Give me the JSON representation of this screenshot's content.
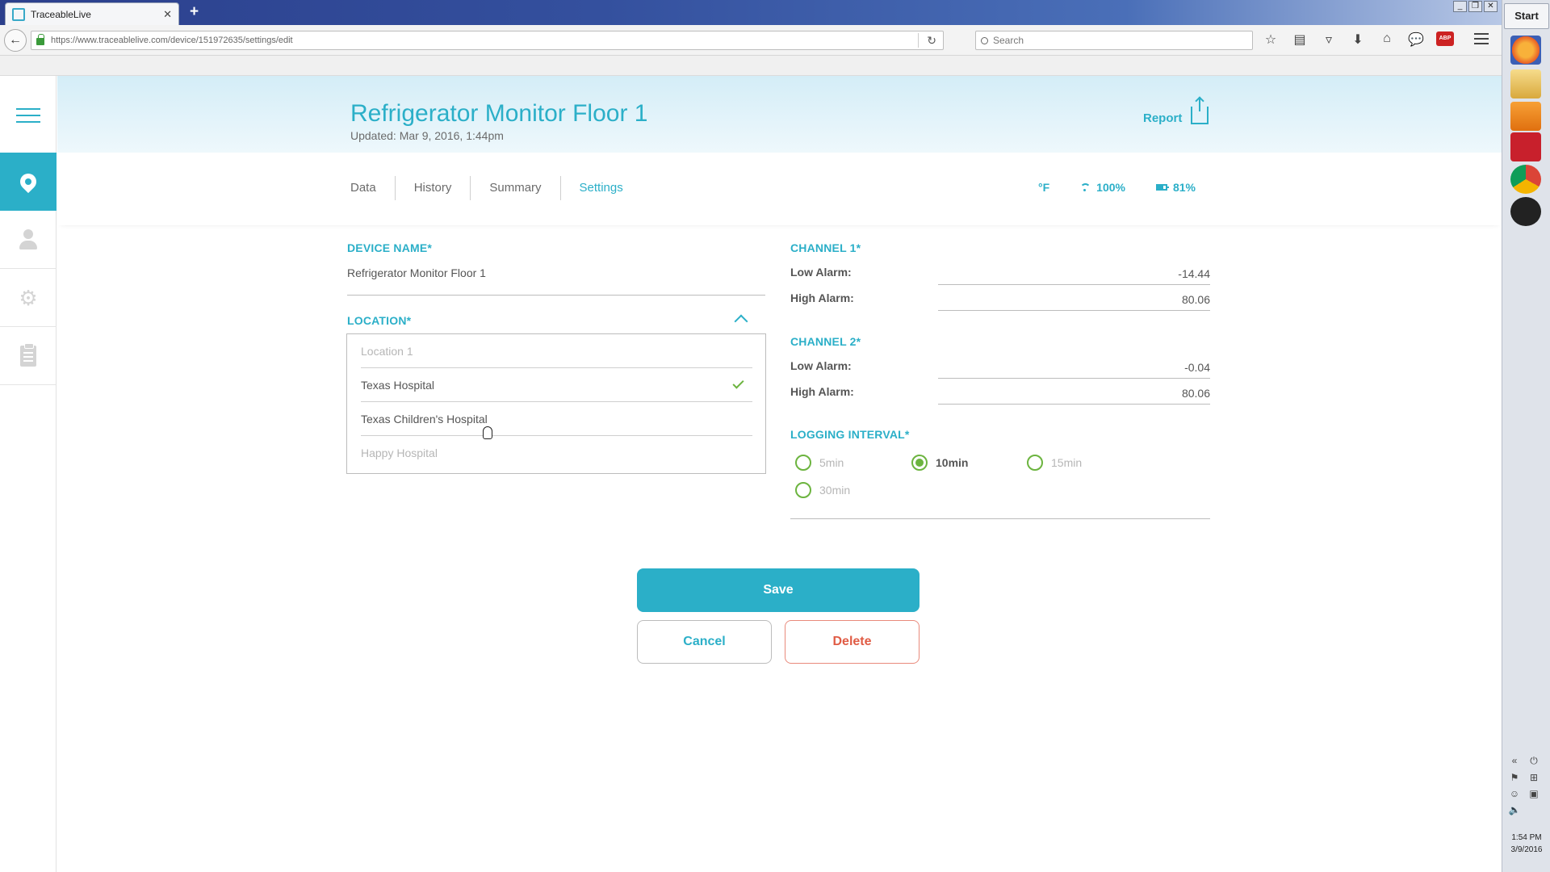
{
  "browser": {
    "tab_title": "TraceableLive",
    "url": "https://www.traceablelive.com/device/151972635/settings/edit",
    "search_placeholder": "Search",
    "abp_label": "ABP"
  },
  "taskbar": {
    "start_label": "Start",
    "clock_time": "1:54 PM",
    "clock_date": "3/9/2016"
  },
  "header": {
    "title": "Refrigerator Monitor Floor 1",
    "updated": "Updated: Mar 9, 2016, 1:44pm",
    "report_label": "Report"
  },
  "tabs": {
    "data": "Data",
    "history": "History",
    "summary": "Summary",
    "settings": "Settings"
  },
  "status": {
    "unit": "°F",
    "signal": "100%",
    "battery": "81%"
  },
  "form": {
    "device_name_label": "DEVICE NAME*",
    "device_name_value": "Refrigerator Monitor Floor 1",
    "location_label": "LOCATION*",
    "locations": [
      "Location 1",
      "Texas Hospital",
      "Texas Children's Hospital",
      "Happy Hospital"
    ],
    "selected_location": "Texas Hospital",
    "channel1_label": "CHANNEL 1*",
    "channel2_label": "CHANNEL 2*",
    "low_alarm_label": "Low Alarm:",
    "high_alarm_label": "High Alarm:",
    "channel1_low": "-14.44",
    "channel1_high": "80.06",
    "channel2_low": "-0.04",
    "channel2_high": "80.06",
    "logging_label": "LOGGING INTERVAL*",
    "intervals": [
      "5min",
      "10min",
      "15min",
      "30min"
    ],
    "selected_interval": "10min"
  },
  "actions": {
    "save": "Save",
    "cancel": "Cancel",
    "delete": "Delete"
  },
  "colors": {
    "accent": "#2bafc8",
    "success": "#6cb43f",
    "danger": "#e05c45"
  }
}
